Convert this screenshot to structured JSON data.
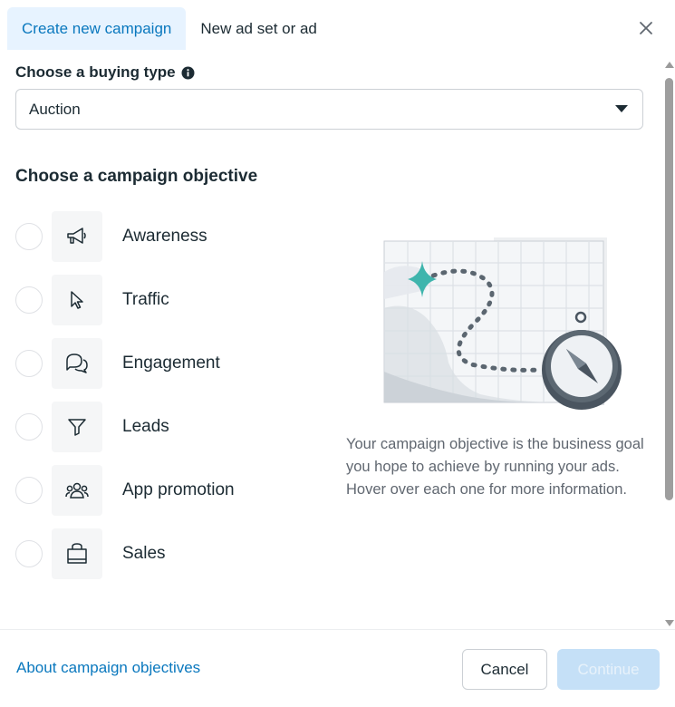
{
  "tabs": [
    {
      "label": "Create new campaign",
      "active": true
    },
    {
      "label": "New ad set or ad",
      "active": false
    }
  ],
  "buying_type": {
    "label": "Choose a buying type",
    "selected": "Auction"
  },
  "objective": {
    "title": "Choose a campaign objective",
    "options": [
      {
        "label": "Awareness",
        "icon": "megaphone-icon"
      },
      {
        "label": "Traffic",
        "icon": "cursor-icon"
      },
      {
        "label": "Engagement",
        "icon": "chat-bubbles-icon"
      },
      {
        "label": "Leads",
        "icon": "filter-icon"
      },
      {
        "label": "App promotion",
        "icon": "people-icon"
      },
      {
        "label": "Sales",
        "icon": "shopping-bag-icon"
      }
    ],
    "description": "Your campaign objective is the business goal you hope to achieve by running your ads. Hover over each one for more information."
  },
  "footer": {
    "about_link": "About campaign objectives",
    "cancel_label": "Cancel",
    "continue_label": "Continue"
  },
  "colors": {
    "accent": "#0a78be",
    "tab_active_bg": "#e7f3ff",
    "continue_disabled_bg": "#c5e0f7",
    "map_teal": "#3fb5ad"
  }
}
